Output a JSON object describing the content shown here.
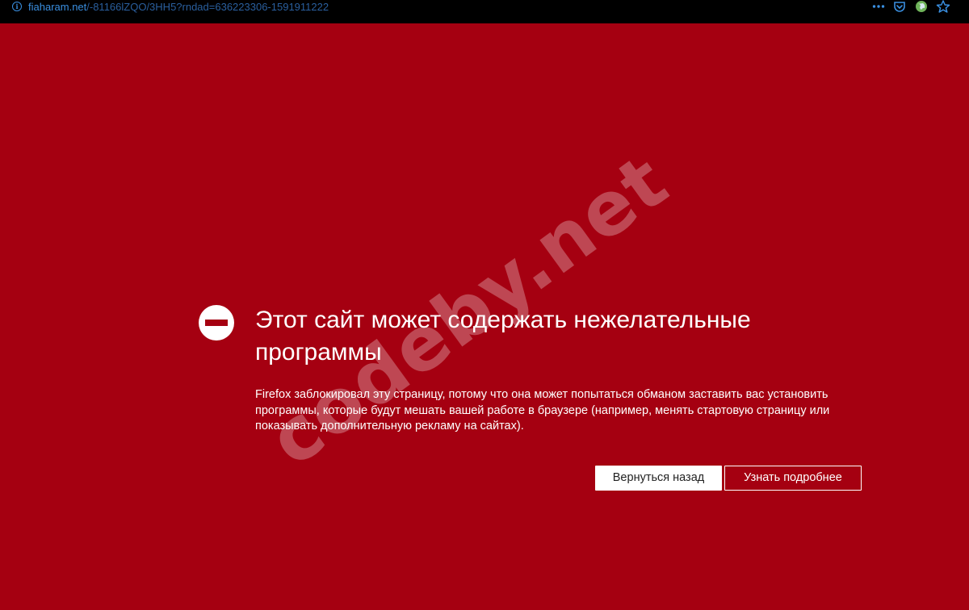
{
  "urlbar": {
    "domain": "fiaharam.net",
    "path": "/-81166lZQO/3HH5?rndad=636223306-1591911222",
    "info_icon_glyph": "i",
    "icons": [
      "page-actions-icon",
      "pocket-icon",
      "extension-globe-icon",
      "bookmark-star-icon"
    ]
  },
  "warning": {
    "icon": "block-icon",
    "title": "Этот сайт может содержать нежелательные программы",
    "description": "Firefox заблокировал эту страницу, потому что она может попытаться обманом заставить вас установить программы, которые будут мешать вашей работе в браузере (например, менять стартовую страницу или показывать дополнительную рекламу на сайтах).",
    "back_button": "Вернуться назад",
    "learn_more_button": "Узнать подробнее"
  },
  "watermark": "codeby.net",
  "colors": {
    "background": "#a50011",
    "urlbar": "#000000",
    "url_accent": "#3a8fe0",
    "text": "#ffffff"
  }
}
